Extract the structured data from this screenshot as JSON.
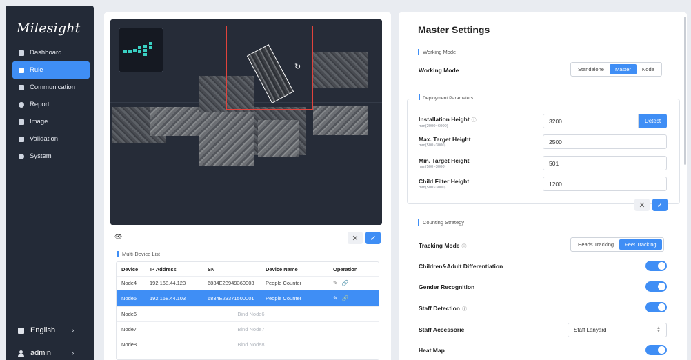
{
  "brand": "Milesight",
  "sidebar": {
    "items": [
      {
        "label": "Dashboard",
        "icon": "dashboard-icon"
      },
      {
        "label": "Rule",
        "icon": "rule-icon",
        "active": true
      },
      {
        "label": "Communication",
        "icon": "communication-icon"
      },
      {
        "label": "Report",
        "icon": "report-icon"
      },
      {
        "label": "Image",
        "icon": "image-icon"
      },
      {
        "label": "Validation",
        "icon": "validation-icon"
      },
      {
        "label": "System",
        "icon": "system-icon"
      }
    ],
    "language": "English",
    "user": "admin",
    "chevron": "›"
  },
  "left": {
    "cancel": "✕",
    "confirm": "✓",
    "eye": "👁",
    "multi_device_list": "Multi-Device List",
    "columns": [
      "Device",
      "IP Address",
      "SN",
      "Device Name",
      "Operation"
    ],
    "rows": [
      {
        "device": "Node4",
        "ip": "192.168.44.123",
        "sn": "6834E23949360003",
        "name": "People Counter"
      },
      {
        "device": "Node5",
        "ip": "192.168.44.103",
        "sn": "6834E23371500001",
        "name": "People Counter",
        "selected": true
      }
    ],
    "unbound": [
      {
        "device": "Node6",
        "bind": "Bind Node6"
      },
      {
        "device": "Node7",
        "bind": "Bind Node7"
      },
      {
        "device": "Node8",
        "bind": "Bind Node8"
      }
    ],
    "edit_glyph": "✎",
    "link_glyph": "🔗"
  },
  "right": {
    "title": "Master Settings",
    "working_mode_section": "Working Mode",
    "working_mode_label": "Working Mode",
    "working_mode_options": [
      "Standalone",
      "Master",
      "Node"
    ],
    "working_mode_selected": "Master",
    "deployment_section": "Deployment Parameters",
    "installation_height_label": "Installation Height",
    "installation_height_range": "mm(2000~6000)",
    "installation_height_value": "3200",
    "detect_label": "Detect",
    "max_target_label": "Max. Target Height",
    "max_target_range": "mm(500~3000)",
    "max_target_value": "2500",
    "min_target_label": "Min. Target Height",
    "min_target_range": "mm(500~3000)",
    "min_target_value": "501",
    "child_filter_label": "Child Filter Height",
    "child_filter_range": "mm(500~3000)",
    "child_filter_value": "1200",
    "counting_section": "Counting Strategy",
    "tracking_mode_label": "Tracking Mode",
    "tracking_options": [
      "Heads Tracking",
      "Feet Tracking"
    ],
    "tracking_selected": "Feet Tracking",
    "children_adult_label": "Children&Adult Differentiation",
    "gender_label": "Gender Recognition",
    "staff_detection_label": "Staff Detection",
    "staff_accessorie_label": "Staff Accessorie",
    "staff_accessorie_value": "Staff Lanyard",
    "heat_map_label": "Heat Map",
    "info_glyph": "ⓘ",
    "toggles": {
      "children_adult": true,
      "gender": true,
      "staff_detection": true,
      "heat_map": true
    }
  },
  "colors": {
    "accent": "#3f8ef5",
    "sidebar_bg": "#232a37",
    "selection_rect": "#e0433c"
  }
}
